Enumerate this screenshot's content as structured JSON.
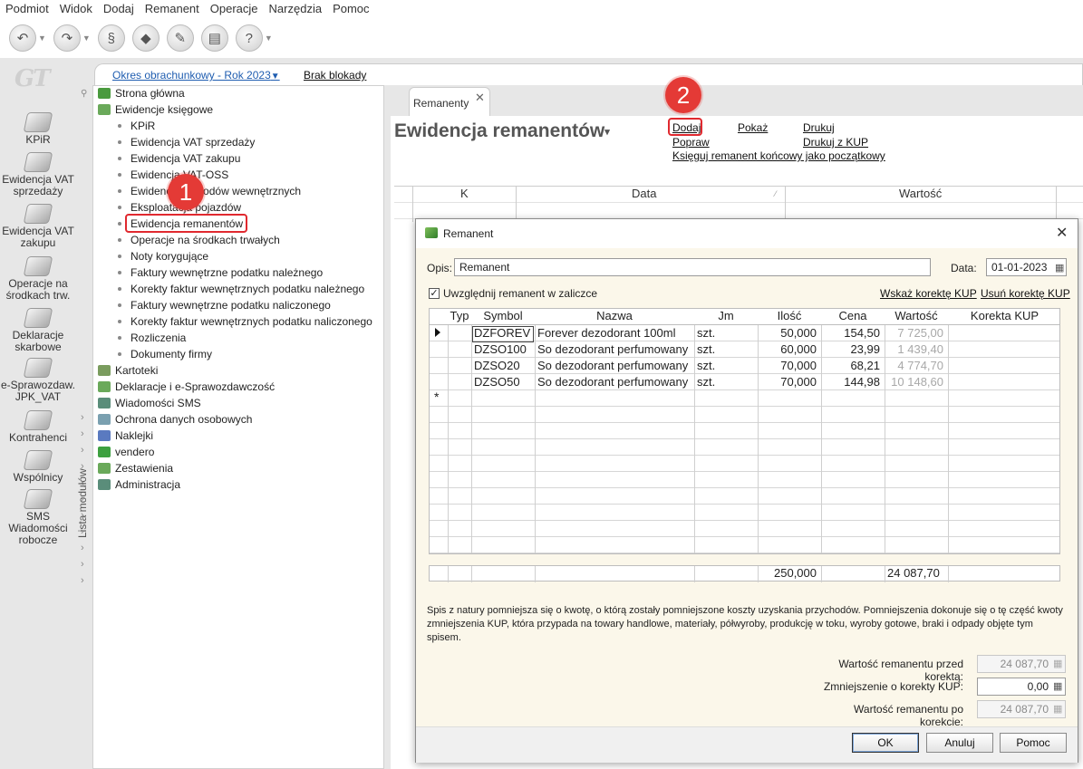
{
  "menubar": [
    "Podmiot",
    "Widok",
    "Dodaj",
    "Remanent",
    "Operacje",
    "Narzędzia",
    "Pomoc"
  ],
  "toolbar": {
    "buttons": [
      "back-icon",
      "forward-icon",
      "scale-icon",
      "eraser-icon",
      "wrench-icon",
      "print-icon",
      "help-icon"
    ]
  },
  "modules": [
    {
      "label": "KPiR",
      "icon": "book-icon"
    },
    {
      "label": "Ewidencja VAT sprzedaży",
      "icon": "ledger-icon"
    },
    {
      "label": "Ewidencja VAT zakupu",
      "icon": "ledger-icon"
    },
    {
      "label": "Operacje na środkach trw.",
      "icon": "asset-icon"
    },
    {
      "label": "Deklaracje skarbowe",
      "icon": "declaration-icon"
    },
    {
      "label": "e-Sprawozdaw. JPK_VAT",
      "icon": "jpk-icon"
    },
    {
      "label": "Kontrahenci",
      "icon": "person-icon"
    },
    {
      "label": "Wspólnicy",
      "icon": "partners-icon"
    },
    {
      "label": "SMS Wiadomości robocze",
      "icon": "sms-icon"
    }
  ],
  "header": {
    "period": "Okres obrachunkowy - Rok 2023",
    "lock": "Brak blokady"
  },
  "sidebar": {
    "panel_label": "Lista modułów",
    "tree": [
      {
        "label": "Strona główna",
        "level": 0
      },
      {
        "label": "Ewidencje księgowe",
        "level": 0
      },
      {
        "label": "KPiR",
        "level": 1
      },
      {
        "label": "Ewidencja VAT sprzedaży",
        "level": 1
      },
      {
        "label": "Ewidencja VAT zakupu",
        "level": 1
      },
      {
        "label": "Ewidencja VAT-OSS",
        "level": 1
      },
      {
        "label": "Ewidencja dowodów wewnętrznych",
        "level": 1
      },
      {
        "label": "Eksploatacja pojazdów",
        "level": 1
      },
      {
        "label": "Ewidencja remanentów",
        "level": 1
      },
      {
        "label": "Operacje na środkach trwałych",
        "level": 1
      },
      {
        "label": "Noty korygujące",
        "level": 1
      },
      {
        "label": "Faktury wewnętrzne podatku należnego",
        "level": 1
      },
      {
        "label": "Korekty faktur wewnętrznych podatku należnego",
        "level": 1
      },
      {
        "label": "Faktury wewnętrzne podatku naliczonego",
        "level": 1
      },
      {
        "label": "Korekty faktur wewnętrznych podatku naliczonego",
        "level": 1
      },
      {
        "label": "Rozliczenia",
        "level": 1
      },
      {
        "label": "Dokumenty firmy",
        "level": 1
      },
      {
        "label": "Kartoteki",
        "level": 0
      },
      {
        "label": "Deklaracje i e-Sprawozdawczość",
        "level": 0
      },
      {
        "label": "Wiadomości SMS",
        "level": 0
      },
      {
        "label": "Ochrona danych osobowych",
        "level": 0
      },
      {
        "label": "Naklejki",
        "level": 0
      },
      {
        "label": "vendero",
        "level": 0
      },
      {
        "label": "Zestawienia",
        "level": 0
      },
      {
        "label": "Administracja",
        "level": 0
      }
    ]
  },
  "annotations": {
    "step1": "1",
    "step2": "2"
  },
  "main": {
    "tab_label": "Remanenty",
    "title": "Ewidencja remanentów",
    "actions": {
      "add": "Dodaj",
      "show": "Pokaż",
      "print": "Drukuj",
      "edit": "Popraw",
      "print_kup": "Drukuj z KUP",
      "post_closing": "Księguj remanent końcowy jako początkowy"
    },
    "grid_headers": [
      "K",
      "Data",
      "Wartość"
    ]
  },
  "dialog": {
    "title": "Remanent",
    "opis_label": "Opis:",
    "opis_value": "Remanent",
    "data_label": "Data:",
    "data_value": "01-01-2023",
    "checkbox_label": "Uwzględnij remanent w zaliczce",
    "checkbox_checked": "✓",
    "show_correction": "Wskaż korektę KUP",
    "remove_correction": "Usuń korektę KUP",
    "columns": [
      "Typ",
      "Symbol",
      "Nazwa",
      "Jm",
      "Ilość",
      "Cena",
      "Wartość",
      "Korekta KUP"
    ],
    "rows": [
      {
        "symbol": "DZFOREV",
        "nazwa": "Forever dezodorant 100ml",
        "jm": "szt.",
        "ilosc": "50,000",
        "cena": "154,50",
        "wartosc": "7 725,00"
      },
      {
        "symbol": "DZSO100",
        "nazwa": "So dezodorant perfumowany",
        "jm": "szt.",
        "ilosc": "60,000",
        "cena": "23,99",
        "wartosc": "1 439,40"
      },
      {
        "symbol": "DZSO20",
        "nazwa": "So dezodorant perfumowany",
        "jm": "szt.",
        "ilosc": "70,000",
        "cena": "68,21",
        "wartosc": "4 774,70"
      },
      {
        "symbol": "DZSO50",
        "nazwa": "So dezodorant perfumowany",
        "jm": "szt.",
        "ilosc": "70,000",
        "cena": "144,98",
        "wartosc": "10 148,60"
      }
    ],
    "new_row_marker": "*",
    "totals": {
      "ilosc": "250,000",
      "wartosc": "24 087,70"
    },
    "description": "Spis z natury pomniejsza się o kwotę, o którą zostały pomniejszone koszty uzyskania przychodów. Pomniejszenia dokonuje się o tę część kwoty zmniejszenia KUP, która przypada na towary handlowe, materiały, półwyroby, produkcję w toku, wyroby gotowe, braki i odpady objęte tym spisem.",
    "value_before_label": "Wartość remanentu przed korektą:",
    "value_before": "24 087,70",
    "reduction_label": "Zmniejszenie o korekty KUP:",
    "reduction": "0,00",
    "value_after_label": "Wartość remanentu po korekcie:",
    "value_after": "24 087,70",
    "buttons": {
      "ok": "OK",
      "cancel": "Anuluj",
      "help": "Pomoc"
    }
  }
}
